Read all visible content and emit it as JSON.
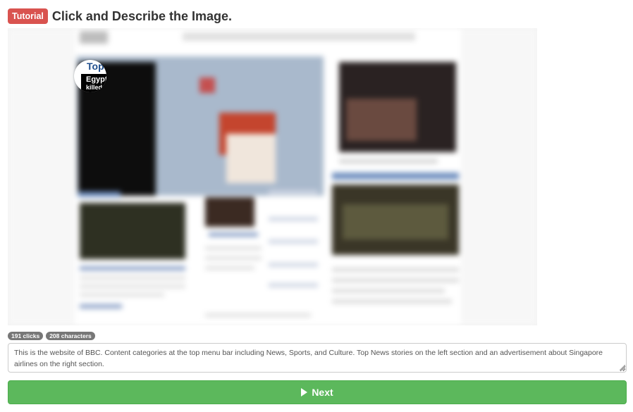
{
  "header": {
    "badge": "Tutorial",
    "title": "Click and Describe the Image."
  },
  "screenshot": {
    "description_of_content": "",
    "focus_bubble": {
      "title_fragment": "Top",
      "headline_line1": "Egypt",
      "headline_line2": "killed"
    }
  },
  "stats": {
    "clicks": "191 clicks",
    "characters": "208 characters"
  },
  "description": {
    "value": "This is the website of BBC. Content categories at the top menu bar including News, Sports, and Culture. Top News stories on the left section and an advertisement about Singapore airlines on the right section."
  },
  "next_button": {
    "label": "Next",
    "color": "#5cb85c"
  },
  "colors": {
    "tutorial_badge": "#d9534f",
    "stat_badge": "#777777"
  }
}
